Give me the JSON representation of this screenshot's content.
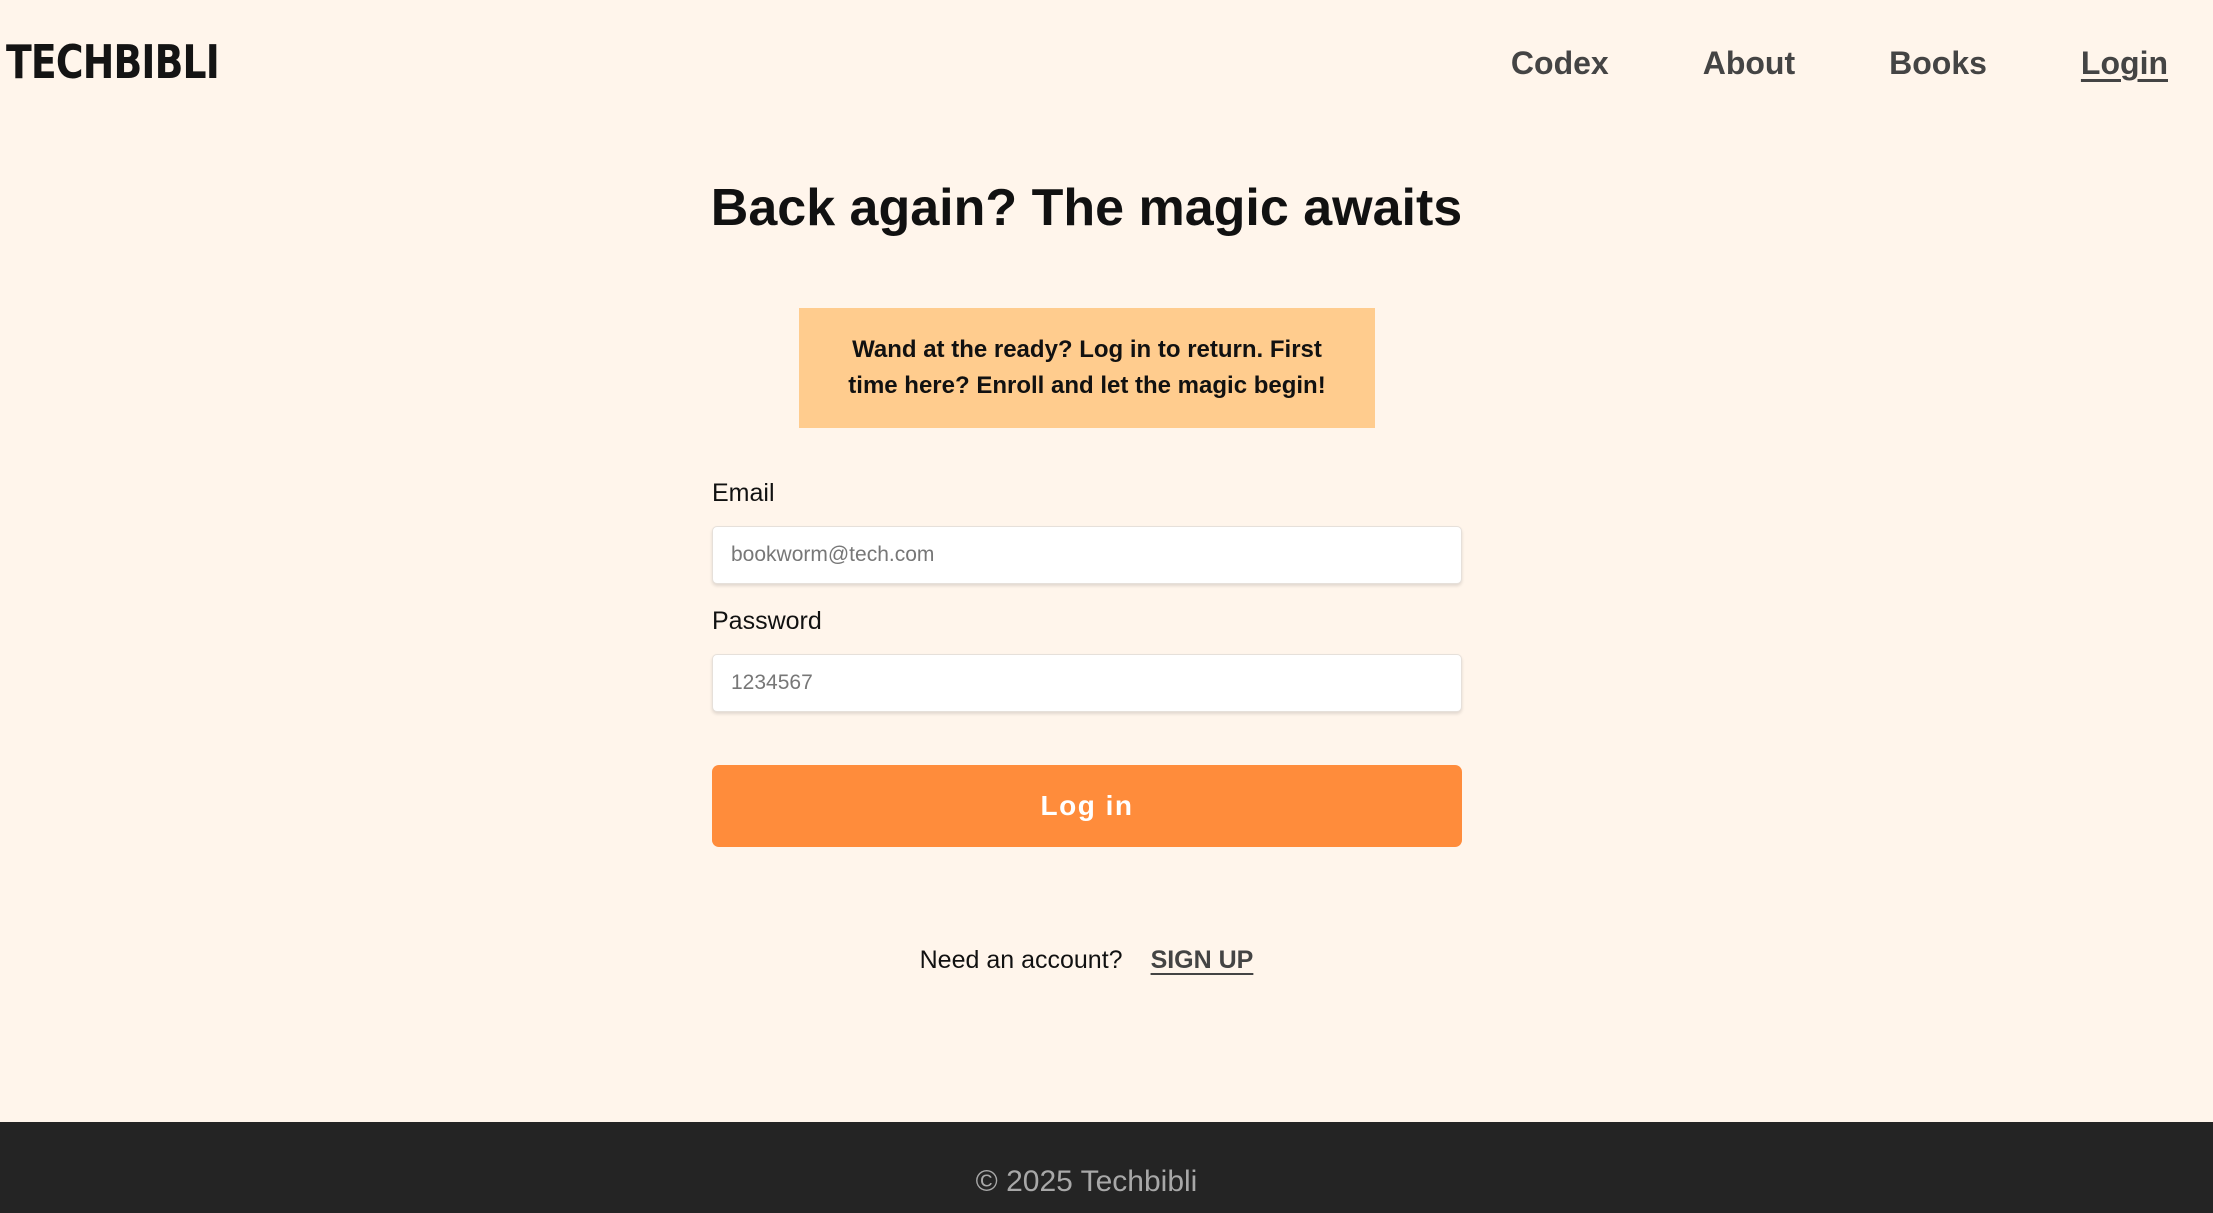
{
  "header": {
    "logo": "TECHBIBLI",
    "nav": [
      {
        "label": "Codex",
        "active": false
      },
      {
        "label": "About",
        "active": false
      },
      {
        "label": "Books",
        "active": false
      },
      {
        "label": "Login",
        "active": true
      }
    ]
  },
  "main": {
    "title": "Back again? The magic awaits",
    "notice": "Wand at the ready? Log in to return. First time here? Enroll and let the magic begin!",
    "form": {
      "email_label": "Email",
      "email_placeholder": "bookworm@tech.com",
      "email_value": "",
      "password_label": "Password",
      "password_placeholder": "1234567",
      "password_value": "",
      "submit_label": "Log in"
    },
    "signup": {
      "prompt": "Need an account?",
      "link_label": "SIGN UP"
    }
  },
  "footer": {
    "text": "© 2025 Techbibli"
  },
  "colors": {
    "background": "#fff5eb",
    "notice_bg": "#ffcc8e",
    "button_bg": "#ff8c3b",
    "footer_bg": "#242424"
  }
}
